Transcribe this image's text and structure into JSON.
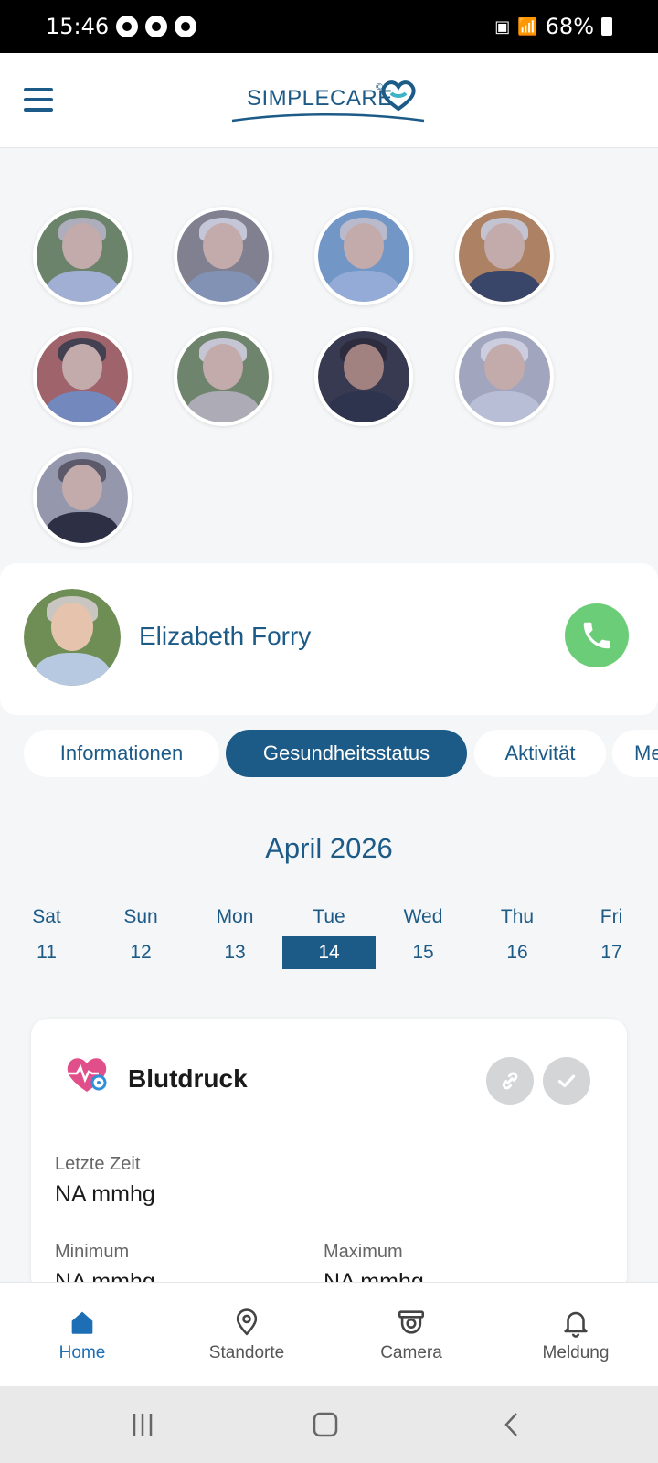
{
  "status_bar": {
    "time": "15:46",
    "battery": "68%"
  },
  "header": {
    "logo_text": "SIMPLECARE",
    "logo_mark": "©"
  },
  "contacts": [
    {
      "name": "contact-1",
      "hair": "#c9c6c2",
      "body": "#b7c9e0",
      "bg": "#6f8e55"
    },
    {
      "name": "contact-2",
      "hair": "#e8e8e8",
      "body": "#8ea2b7",
      "bg": "#8d8a88"
    },
    {
      "name": "contact-3",
      "hair": "#d9d9d9",
      "body": "#a9c3e6",
      "bg": "#7aa7cf"
    },
    {
      "name": "contact-4",
      "hair": "#e6e3de",
      "body": "#2e3d55",
      "bg": "#c98b4b"
    },
    {
      "name": "contact-5",
      "hair": "#3a3433",
      "body": "#7b95c2",
      "bg": "#b46356"
    },
    {
      "name": "contact-6",
      "hair": "#e9e6e1",
      "body": "#c8c3b8",
      "bg": "#768f58"
    },
    {
      "name": "contact-7",
      "hair": "#1e1a1a",
      "body": "#20252f",
      "bg": "#2d2d33"
    },
    {
      "name": "contact-8",
      "hair": "#f2f2f2",
      "body": "#d8dde6",
      "bg": "#b9bcc4"
    },
    {
      "name": "contact-9",
      "hair": "#5b5655",
      "body": "#1e1e22",
      "bg": "#a9a9ad"
    }
  ],
  "selected_person": {
    "name": "Elizabeth Forry"
  },
  "tabs": [
    {
      "label": "Informationen",
      "active": false
    },
    {
      "label": "Gesundheitsstatus",
      "active": true
    },
    {
      "label": "Aktivität",
      "active": false
    },
    {
      "label": "Me",
      "active": false
    }
  ],
  "calendar": {
    "month": "April 2026",
    "days": [
      {
        "name": "Sat",
        "num": "11",
        "active": false
      },
      {
        "name": "Sun",
        "num": "12",
        "active": false
      },
      {
        "name": "Mon",
        "num": "13",
        "active": false
      },
      {
        "name": "Tue",
        "num": "14",
        "active": true
      },
      {
        "name": "Wed",
        "num": "15",
        "active": false
      },
      {
        "name": "Thu",
        "num": "16",
        "active": false
      },
      {
        "name": "Fri",
        "num": "17",
        "active": false
      }
    ]
  },
  "metric": {
    "title": "Blutdruck",
    "last_label": "Letzte Zeit",
    "last_value": "NA mmhg",
    "min_label": "Minimum",
    "min_value": "NA mmhg",
    "max_label": "Maximum",
    "max_value": "NA mmhg"
  },
  "bottom_nav": [
    {
      "label": "Home",
      "icon": "home-icon",
      "active": true
    },
    {
      "label": "Standorte",
      "icon": "location-pin-icon",
      "active": false
    },
    {
      "label": "Camera",
      "icon": "camera-icon",
      "active": false
    },
    {
      "label": "Meldung",
      "icon": "bell-icon",
      "active": false
    }
  ],
  "colors": {
    "primary": "#1c5a87",
    "call_green": "#6ccd78",
    "active_nav": "#1c6eb5",
    "heart_pink": "#e04f8a"
  }
}
